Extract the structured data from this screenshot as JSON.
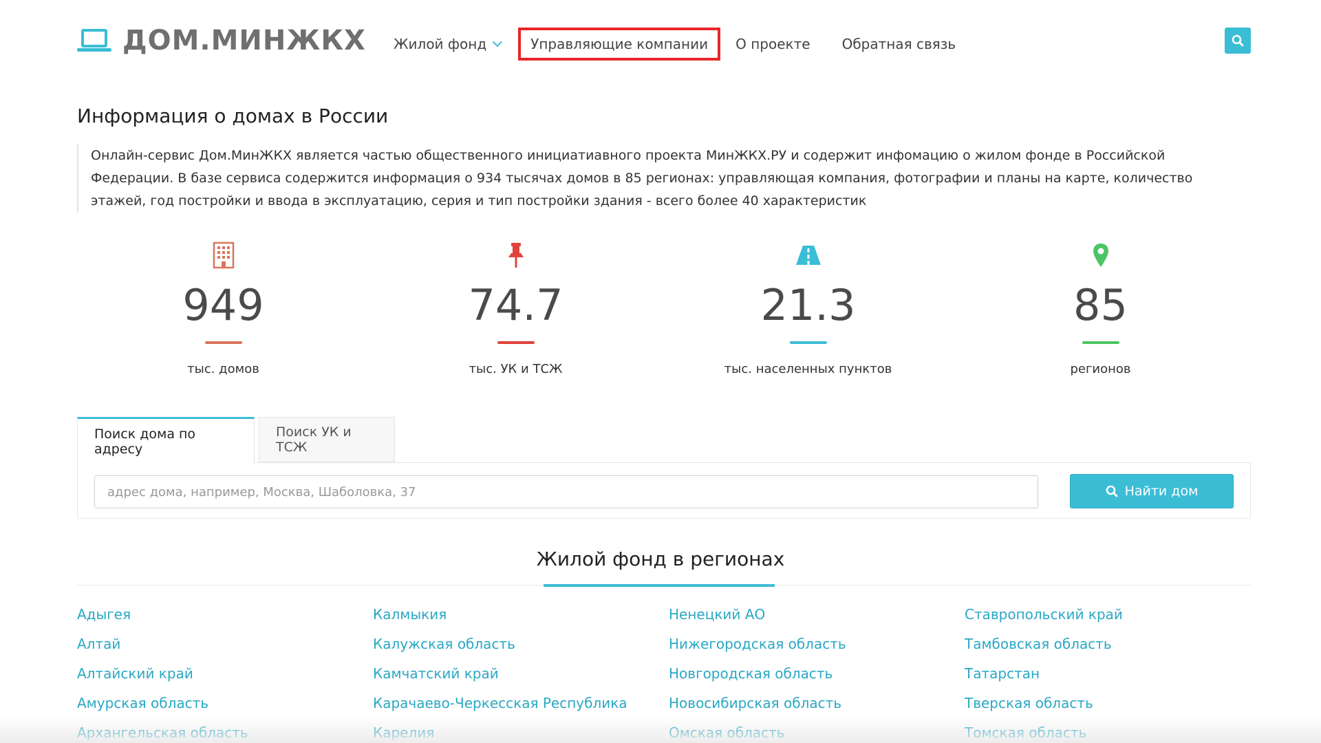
{
  "header": {
    "logo_text": "ДОМ.МИНЖКХ",
    "nav": [
      {
        "label": "Жилой фонд"
      },
      {
        "label": "Управляющие компании"
      },
      {
        "label": "О проекте"
      },
      {
        "label": "Обратная связь"
      }
    ],
    "search_icon": "search-icon"
  },
  "intro": {
    "title": "Информация о домах в России",
    "text": "Онлайн-сервис Дом.МинЖКХ является частью общественного инициатиавного проекта МинЖКХ.РУ и содержит инфомацию о жилом фонде в Российской Федерации. В базе сервиса содержится информация о 934 тысячах домов в 85 регионах: управляющая компания, фотографии и планы на карте, количество этажей, год постройки и ввода в эксплуатацию, серия и тип постройки здания - всего более 40 характеристик"
  },
  "stats": [
    {
      "icon": "building-icon",
      "value": "949",
      "label": "тыс. домов",
      "color": "#d9765c"
    },
    {
      "icon": "pushpin-icon",
      "value": "74.7",
      "label": "тыс. УК и ТСЖ",
      "color": "#e0443c"
    },
    {
      "icon": "road-icon",
      "value": "21.3",
      "label": "тыс. населенных пунктов",
      "color": "#3bbdd6"
    },
    {
      "icon": "map-marker-icon",
      "value": "85",
      "label": "регионов",
      "color": "#4cc463"
    }
  ],
  "search": {
    "tabs": [
      {
        "label": "Поиск дома по адресу"
      },
      {
        "label": "Поиск УК и ТСЖ"
      }
    ],
    "placeholder": "адрес дома, например, Москва, Шаболовка, 37",
    "button_label": "Найти дом"
  },
  "regions": {
    "title": "Жилой фонд в регионах",
    "columns": [
      [
        "Адыгея",
        "Алтай",
        "Алтайский край",
        "Амурская область",
        "Архангельская область"
      ],
      [
        "Калмыкия",
        "Калужская область",
        "Камчатский край",
        "Карачаево-Черкесская Республика",
        "Карелия"
      ],
      [
        "Ненецкий АО",
        "Нижегородская область",
        "Новгородская область",
        "Новосибирская область",
        "Омская область"
      ],
      [
        "Ставропольский край",
        "Тамбовская область",
        "Татарстан",
        "Тверская область",
        "Томская область"
      ]
    ]
  },
  "colors": {
    "accent": "#3bbdd6",
    "highlight": "#e8262a",
    "link": "#2aa8c4"
  }
}
